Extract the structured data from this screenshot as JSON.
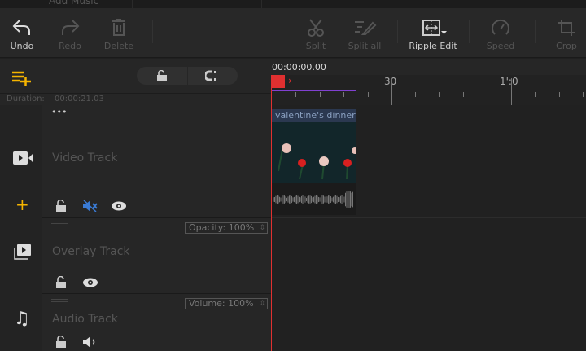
{
  "top": {
    "add_music": "Add Music"
  },
  "toolbar": {
    "undo": "Undo",
    "redo": "Redo",
    "delete": "Delete",
    "split": "Split",
    "split_all": "Split all",
    "ripple_edit": "Ripple Edit",
    "speed": "Speed",
    "crop": "Crop"
  },
  "ruler": {
    "current_time": "00:00:00.00",
    "label_30": "30",
    "label_60": "1':0"
  },
  "duration": {
    "label": "Duration:",
    "value": "00:00:21.03"
  },
  "tracks": {
    "video": "Video Track",
    "overlay": "Overlay Track",
    "audio": "Audio Track",
    "opacity": "Opacity: 100%",
    "volume": "Volume: 100%",
    "more": "•••"
  },
  "clip": {
    "title": "valentine's dinner"
  },
  "colors": {
    "accent": "#f5b400",
    "playhead": "#e03030",
    "mute_active": "#3a7bd5",
    "progress": "#8040d0"
  }
}
